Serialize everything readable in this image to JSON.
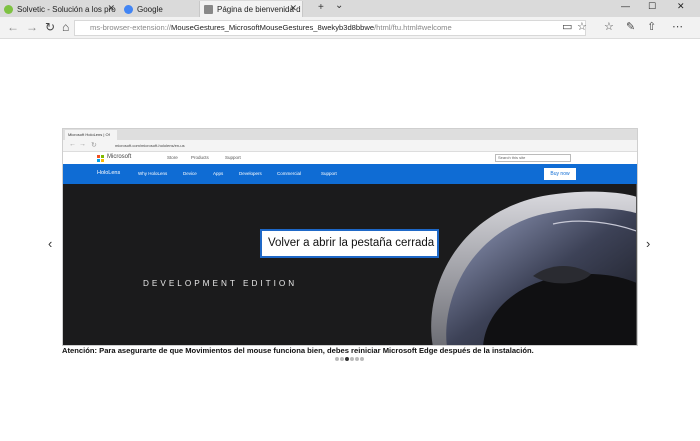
{
  "tabs": [
    {
      "label": "Solvetic - Solución a los pro",
      "favicon_color": "#7ec242"
    },
    {
      "label": "Google",
      "favicon_color": "#4285f4"
    },
    {
      "label": "Página de bienvenida d",
      "favicon_color": "#888888",
      "active": true
    }
  ],
  "tab_close_glyph": "✕",
  "new_tab_glyph": "+",
  "tab_list_glyph": "⌄",
  "window_controls": {
    "minimize": "—",
    "maximize": "☐",
    "close": "✕"
  },
  "address": {
    "scheme": "ms-browser-extension://",
    "host": "MouseGestures_MicrosoftMouseGestures_8wekyb3d8bbwe",
    "path": "/html/ftu.html#welcome"
  },
  "nav": {
    "back": "←",
    "forward": "→",
    "refresh": "↻",
    "home": "⌂"
  },
  "toolbar_icons": [
    "reading-view-icon",
    "favorites-star-icon",
    "favorites-hub-icon",
    "notes-icon",
    "share-icon",
    "more-icon"
  ],
  "toolbar_glyphs": [
    "▭",
    "☆",
    "☆",
    "✎",
    "⇧",
    "⋯"
  ],
  "carousel": {
    "prev": "‹",
    "next": "›",
    "dots": 6,
    "active_index": 2
  },
  "inner_screenshot": {
    "tab_label": "Microsoft HoloLens | Of",
    "url": "microsoft.com/microsoft-hololens/en-us",
    "ms_brand": "Microsoft",
    "ms_nav": [
      "Store",
      "Products",
      "Support"
    ],
    "search_placeholder": "Search this site",
    "hololens_nav": [
      "HoloLens",
      "Why HoloLens",
      "Device",
      "Apps",
      "Developers",
      "Commercial",
      "Support"
    ],
    "buy_label": "Buy now",
    "hero_text": "DEVELOPMENT EDITION"
  },
  "tooltip": "Volver a abrir la pestaña cerrada",
  "notice": "Atención: Para asegurarte de que Movimientos del mouse funciona bien, debes reiniciar Microsoft Edge después de la instalación.",
  "colors": {
    "accent": "#1e68c7",
    "hololens_blue": "#0f6cd4"
  }
}
